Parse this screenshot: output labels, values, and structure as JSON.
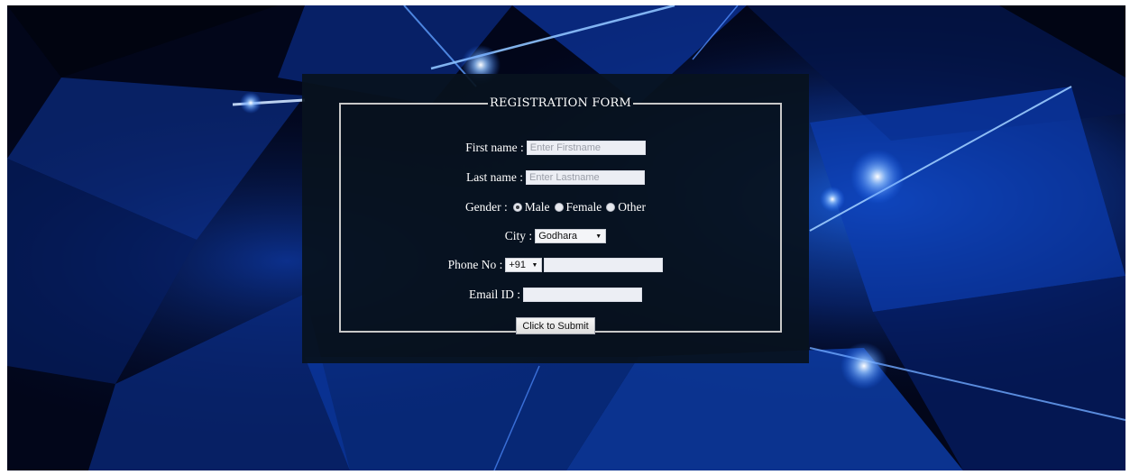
{
  "form": {
    "legend": "REGISTRATION FORM",
    "first_name": {
      "label": "First name :",
      "placeholder": "Enter Firstname",
      "value": ""
    },
    "last_name": {
      "label": "Last name :",
      "placeholder": "Enter Lastname",
      "value": ""
    },
    "gender": {
      "label": "Gender :",
      "options": [
        "Male",
        "Female",
        "Other"
      ],
      "selected": "Male"
    },
    "city": {
      "label": "City :",
      "selected": "Godhara"
    },
    "phone": {
      "label": "Phone No :",
      "code_selected": "+91",
      "value": ""
    },
    "email": {
      "label": "Email ID :",
      "value": ""
    },
    "submit_label": "Click to Submit"
  },
  "theme": {
    "background": "#02061a",
    "panel": "#08121e",
    "border": "#c8c8c8",
    "text": "#ffffff",
    "accent_light": "#1e6cff"
  }
}
